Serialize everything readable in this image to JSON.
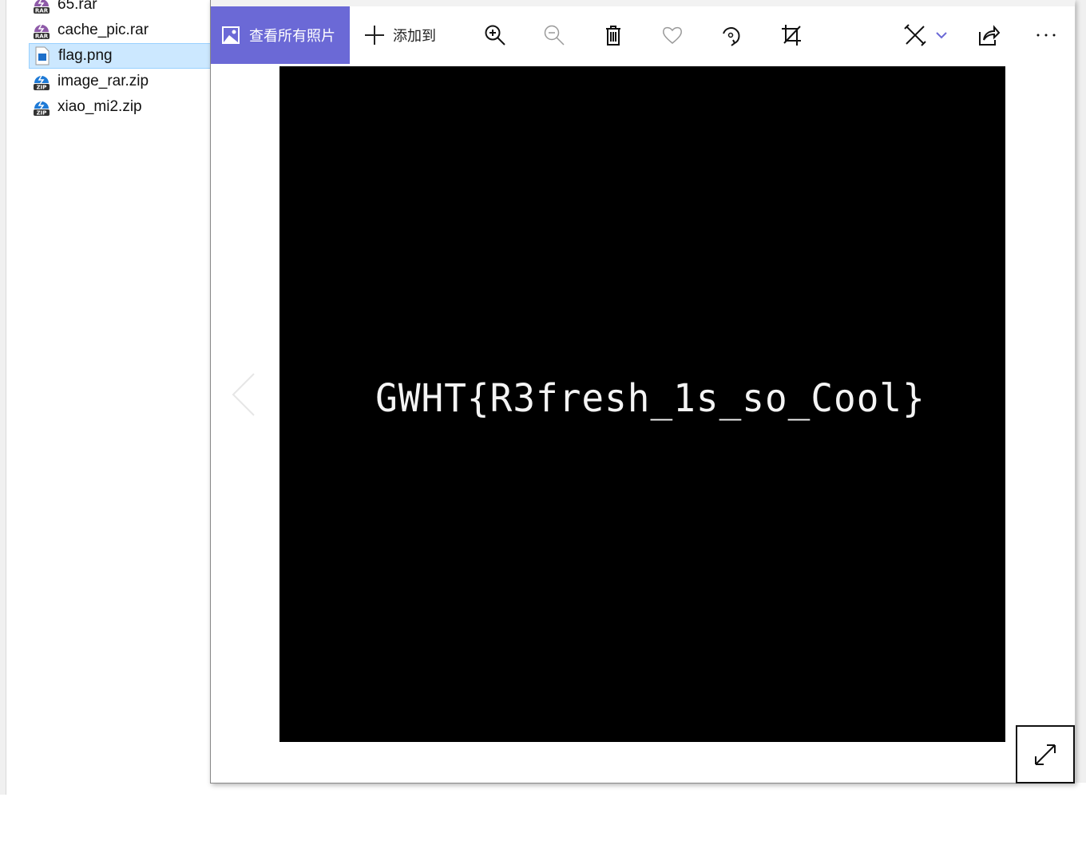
{
  "explorer": {
    "files": [
      {
        "name": "65.rar",
        "type": "rar"
      },
      {
        "name": "cache_pic.rar",
        "type": "rar"
      },
      {
        "name": "flag.png",
        "type": "png",
        "selected": true
      },
      {
        "name": "image_rar.zip",
        "type": "zip"
      },
      {
        "name": "xiao_mi2.zip",
        "type": "zip"
      }
    ],
    "badges": {
      "rar": "RAR",
      "zip": "ZIP"
    }
  },
  "photos": {
    "toolbar": {
      "view_all": "查看所有照片",
      "add_to": "添加到"
    },
    "image_text": "GWHT{R3fresh_1s_so_Cool}",
    "accent": "#6b69d6"
  }
}
